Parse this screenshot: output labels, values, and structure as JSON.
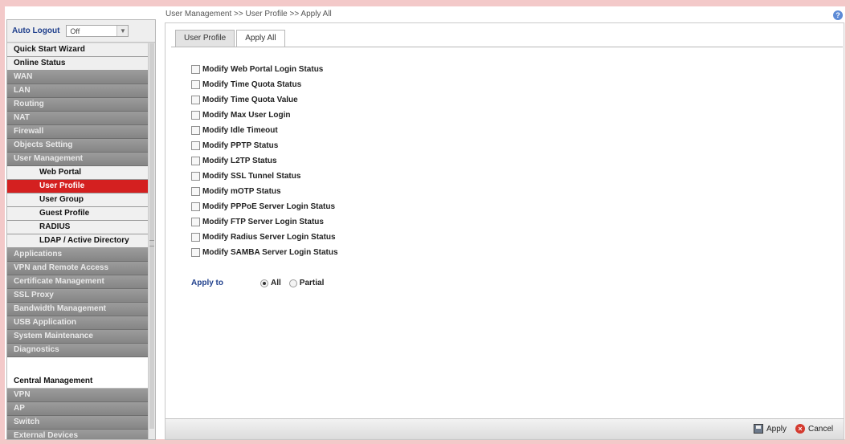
{
  "breadcrumb": "User Management >> User Profile >> Apply All",
  "help_icon": "?",
  "sidebar": {
    "autologout_label": "Auto Logout",
    "autologout_value": "Off",
    "items": [
      {
        "label": "Quick Start Wizard",
        "style": "white"
      },
      {
        "label": "Online Status",
        "style": "white"
      },
      {
        "label": "WAN",
        "style": "grey"
      },
      {
        "label": "LAN",
        "style": "grey"
      },
      {
        "label": "Routing",
        "style": "grey"
      },
      {
        "label": "NAT",
        "style": "grey"
      },
      {
        "label": "Firewall",
        "style": "grey"
      },
      {
        "label": "Objects Setting",
        "style": "grey"
      },
      {
        "label": "User Management",
        "style": "grey"
      },
      {
        "label": "Web Portal",
        "style": "sub"
      },
      {
        "label": "User Profile",
        "style": "sub active"
      },
      {
        "label": "User Group",
        "style": "sub"
      },
      {
        "label": "Guest Profile",
        "style": "sub"
      },
      {
        "label": "RADIUS",
        "style": "sub"
      },
      {
        "label": "LDAP / Active Directory",
        "style": "sub ldap"
      },
      {
        "label": "Applications",
        "style": "grey"
      },
      {
        "label": "VPN and Remote Access",
        "style": "grey"
      },
      {
        "label": "Certificate Management",
        "style": "grey"
      },
      {
        "label": "SSL Proxy",
        "style": "grey"
      },
      {
        "label": "Bandwidth Management",
        "style": "grey"
      },
      {
        "label": "USB Application",
        "style": "grey"
      },
      {
        "label": "System Maintenance",
        "style": "grey"
      },
      {
        "label": "Diagnostics",
        "style": "grey"
      }
    ],
    "central_label": "Central Management",
    "central_items": [
      "VPN",
      "AP",
      "Switch",
      "External Devices"
    ]
  },
  "tabs": [
    "User Profile",
    "Apply All"
  ],
  "active_tab": "Apply All",
  "options": [
    "Modify Web Portal Login Status",
    "Modify Time Quota Status",
    "Modify Time Quota Value",
    "Modify Max User Login",
    "Modify Idle Timeout",
    "Modify PPTP Status",
    "Modify L2TP Status",
    "Modify SSL Tunnel Status",
    "Modify mOTP Status",
    "Modify PPPoE Server Login Status",
    "Modify FTP Server Login Status",
    "Modify Radius Server Login Status",
    "Modify SAMBA Server Login Status"
  ],
  "apply_to": {
    "label": "Apply to",
    "options": [
      "All",
      "Partial"
    ],
    "selected": "All"
  },
  "footer": {
    "apply_label": "Apply",
    "cancel_label": "Cancel"
  }
}
